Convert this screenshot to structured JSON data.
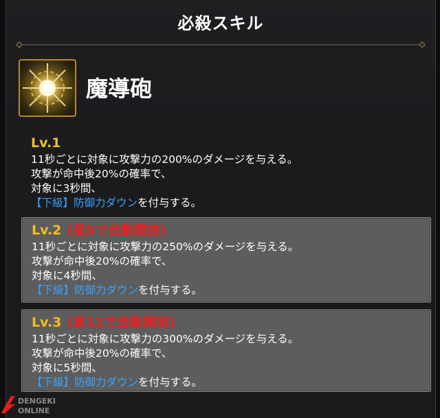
{
  "header": {
    "title": "必殺スキル"
  },
  "skill": {
    "name": "魔導砲",
    "icon": "radiant-burst-icon"
  },
  "levels": [
    {
      "level": "Lv.1",
      "unlock": "",
      "lines": [
        "11秒ごとに対象に攻撃力の200%のダメージを与える。",
        "攻撃が命中後20%の確率で、",
        "対象に3秒間、"
      ],
      "debuff_label": "【下級】防御力ダウン",
      "debuff_suffix": "を付与する。"
    },
    {
      "level": "Lv.2",
      "unlock": "(星5で自動開放)",
      "lines": [
        "11秒ごとに対象に攻撃力の250%のダメージを与える。",
        "攻撃が命中後20%の確率で、",
        "対象に4秒間、"
      ],
      "debuff_label": "【下級】防御力ダウン",
      "debuff_suffix": "を付与する。"
    },
    {
      "level": "Lv.3",
      "unlock": "(星11で自動開放)",
      "lines": [
        "11秒ごとに対象に攻撃力の300%のダメージを与える。",
        "攻撃が命中後20%の確率で、",
        "対象に5秒間、"
      ],
      "debuff_label": "【下級】防御力ダウン",
      "debuff_suffix": "を付与する。"
    }
  ],
  "colors": {
    "level_label": "#f0c020",
    "unlock_label": "#e82020",
    "debuff_label": "#3aa3ff",
    "icon_border": "#b98a2e"
  },
  "watermark": {
    "text": "DENGEKI ONLINE"
  }
}
